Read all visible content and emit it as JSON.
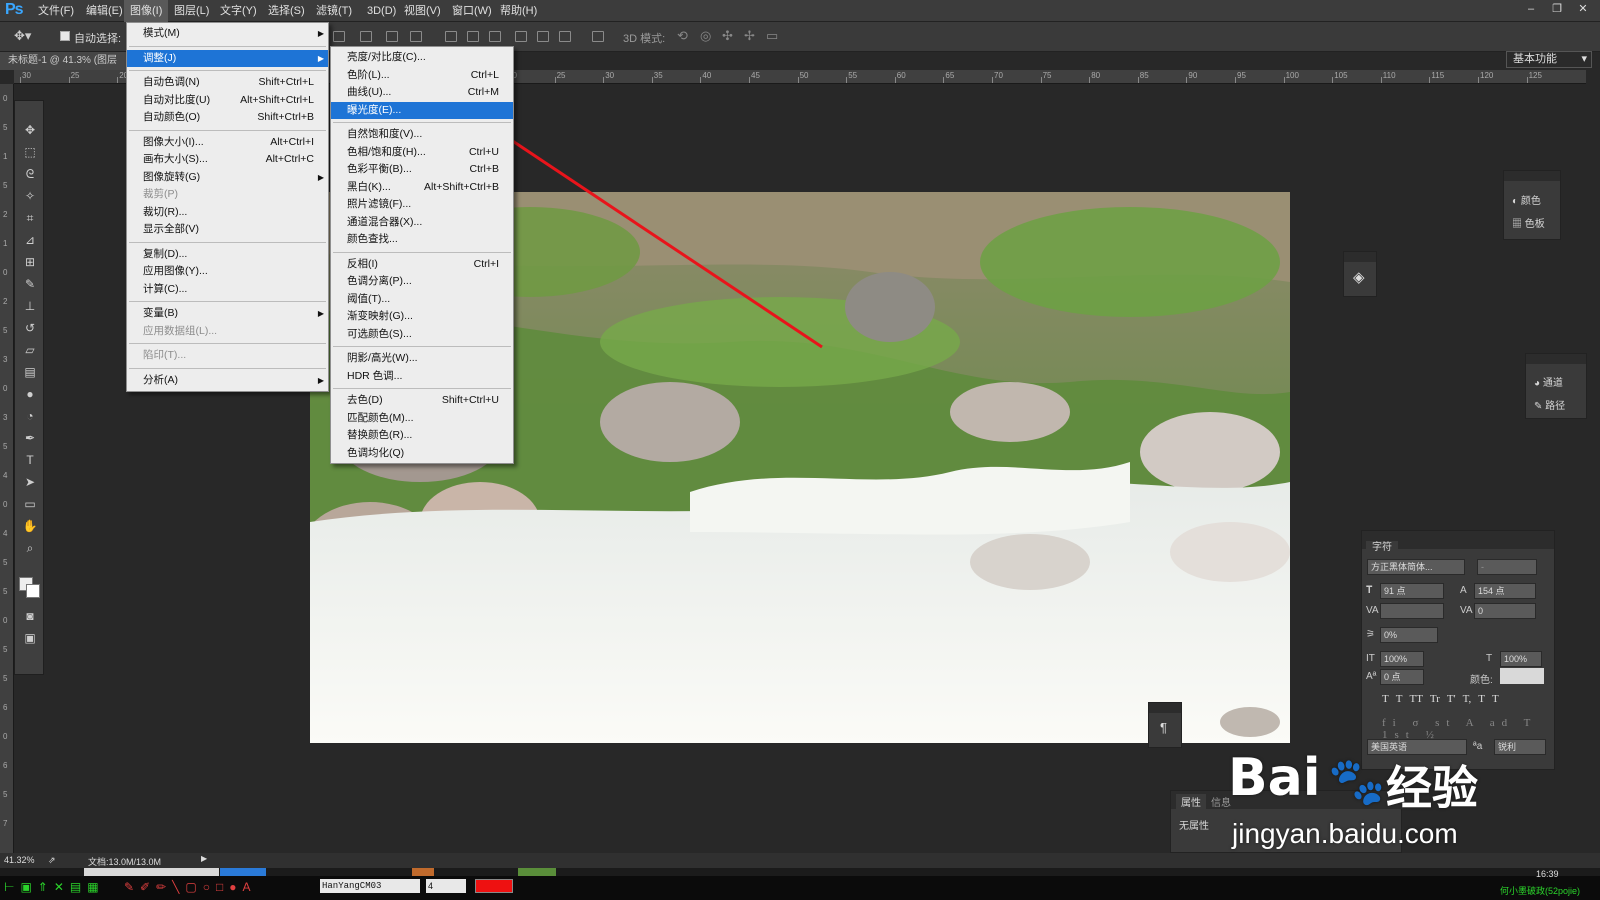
{
  "app": {
    "logo": "Ps"
  },
  "menubar": {
    "items": [
      "文件(F)",
      "编辑(E)",
      "图像(I)",
      "图层(L)",
      "文字(Y)",
      "选择(S)",
      "滤镜(T)",
      "3D(D)",
      "视图(V)",
      "窗口(W)",
      "帮助(H)"
    ],
    "active_index": 2
  },
  "window_controls": [
    "–",
    "❐",
    "✕"
  ],
  "options_bar": {
    "auto_select_label": "自动选择:",
    "mode_label": "3D 模式:",
    "workspace": "基本功能"
  },
  "document_tab": {
    "title": "未标题-1 @ 41.3% (图层"
  },
  "ruler": {
    "h_labels": [
      "30",
      "25",
      "20",
      "15",
      "10",
      "5",
      "0",
      "5",
      "10",
      "15",
      "20",
      "25",
      "30",
      "35",
      "40",
      "45",
      "50",
      "55",
      "60",
      "65",
      "70",
      "75",
      "80",
      "85",
      "90",
      "95",
      "100",
      "105",
      "110",
      "115",
      "120",
      "125"
    ],
    "v_labels": [
      "0",
      "5",
      "1",
      "5",
      "2",
      "1",
      "0",
      "2",
      "5",
      "3",
      "0",
      "3",
      "5",
      "4",
      "0",
      "4",
      "5",
      "5",
      "0",
      "5",
      "5",
      "6",
      "0",
      "6",
      "5",
      "7"
    ]
  },
  "image_menu": {
    "items": [
      {
        "label": "模式(M)",
        "shortcut": "",
        "submenu": true,
        "disabled": false
      },
      {
        "sep": true
      },
      {
        "label": "调整(J)",
        "shortcut": "",
        "submenu": true,
        "disabled": false,
        "highlight": true
      },
      {
        "sep": true
      },
      {
        "label": "自动色调(N)",
        "shortcut": "Shift+Ctrl+L"
      },
      {
        "label": "自动对比度(U)",
        "shortcut": "Alt+Shift+Ctrl+L"
      },
      {
        "label": "自动颜色(O)",
        "shortcut": "Shift+Ctrl+B"
      },
      {
        "sep": true
      },
      {
        "label": "图像大小(I)...",
        "shortcut": "Alt+Ctrl+I"
      },
      {
        "label": "画布大小(S)...",
        "shortcut": "Alt+Ctrl+C"
      },
      {
        "label": "图像旋转(G)",
        "shortcut": "",
        "submenu": true
      },
      {
        "label": "裁剪(P)",
        "shortcut": "",
        "disabled": true
      },
      {
        "label": "裁切(R)...",
        "shortcut": ""
      },
      {
        "label": "显示全部(V)",
        "shortcut": ""
      },
      {
        "sep": true
      },
      {
        "label": "复制(D)...",
        "shortcut": ""
      },
      {
        "label": "应用图像(Y)...",
        "shortcut": ""
      },
      {
        "label": "计算(C)...",
        "shortcut": ""
      },
      {
        "sep": true
      },
      {
        "label": "变量(B)",
        "shortcut": "",
        "submenu": true
      },
      {
        "label": "应用数据组(L)...",
        "shortcut": "",
        "disabled": true
      },
      {
        "sep": true
      },
      {
        "label": "陷印(T)...",
        "shortcut": "",
        "disabled": true
      },
      {
        "sep": true
      },
      {
        "label": "分析(A)",
        "shortcut": "",
        "submenu": true
      }
    ]
  },
  "adjust_menu": {
    "items": [
      {
        "label": "亮度/对比度(C)...",
        "shortcut": ""
      },
      {
        "label": "色阶(L)...",
        "shortcut": "Ctrl+L"
      },
      {
        "label": "曲线(U)...",
        "shortcut": "Ctrl+M"
      },
      {
        "label": "曝光度(E)...",
        "shortcut": "",
        "highlight": true
      },
      {
        "sep": true
      },
      {
        "label": "自然饱和度(V)...",
        "shortcut": ""
      },
      {
        "label": "色相/饱和度(H)...",
        "shortcut": "Ctrl+U"
      },
      {
        "label": "色彩平衡(B)...",
        "shortcut": "Ctrl+B"
      },
      {
        "label": "黑白(K)...",
        "shortcut": "Alt+Shift+Ctrl+B"
      },
      {
        "label": "照片滤镜(F)...",
        "shortcut": ""
      },
      {
        "label": "通道混合器(X)...",
        "shortcut": ""
      },
      {
        "label": "颜色查找...",
        "shortcut": ""
      },
      {
        "sep": true
      },
      {
        "label": "反相(I)",
        "shortcut": "Ctrl+I"
      },
      {
        "label": "色调分离(P)...",
        "shortcut": ""
      },
      {
        "label": "阈值(T)...",
        "shortcut": ""
      },
      {
        "label": "渐变映射(G)...",
        "shortcut": ""
      },
      {
        "label": "可选颜色(S)...",
        "shortcut": ""
      },
      {
        "sep": true
      },
      {
        "label": "阴影/高光(W)...",
        "shortcut": ""
      },
      {
        "label": "HDR 色调...",
        "shortcut": ""
      },
      {
        "sep": true
      },
      {
        "label": "去色(D)",
        "shortcut": "Shift+Ctrl+U"
      },
      {
        "label": "匹配颜色(M)...",
        "shortcut": ""
      },
      {
        "label": "替换颜色(R)...",
        "shortcut": ""
      },
      {
        "label": "色调均化(Q)",
        "shortcut": ""
      }
    ]
  },
  "right_panels": {
    "color_panel": {
      "items": [
        "颜色",
        "色板"
      ]
    },
    "channels_panel": {
      "items": [
        "通道",
        "路径"
      ]
    },
    "character": {
      "tab": "字符",
      "font_family": "方正黑体简体...",
      "font_style": "-",
      "font_size": "91 点",
      "leading": "154 点",
      "kerning": "",
      "tracking": "0",
      "scale_pct": "0%",
      "vertical_scale": "100%",
      "horizontal_scale": "100%",
      "baseline_shift": "0 点",
      "color_label": "颜色:",
      "language": "美国英语",
      "aa_label": "ªa",
      "antialias": "锐利",
      "style_buttons": [
        "T",
        "T",
        "TT",
        "Tr",
        "T'",
        "T,",
        "T",
        "T"
      ]
    },
    "properties": {
      "tabs": [
        "属性",
        "信息"
      ],
      "content": "无属性"
    }
  },
  "status": {
    "zoom": "41.32%",
    "doc": "文档:13.0M/13.0M"
  },
  "taskbar": {
    "input": "HanYangCM03",
    "num": "4",
    "clock": "16:39",
    "right_text": "何小墨破政(52pojie)"
  },
  "watermark": {
    "brand": "Bai",
    "paw": "du",
    "cn": "经验",
    "url": "jingyan.baidu.com"
  },
  "colors": {
    "accent": "#1e74d6",
    "arrow": "#e8141b",
    "menu_bg": "#ededed"
  }
}
